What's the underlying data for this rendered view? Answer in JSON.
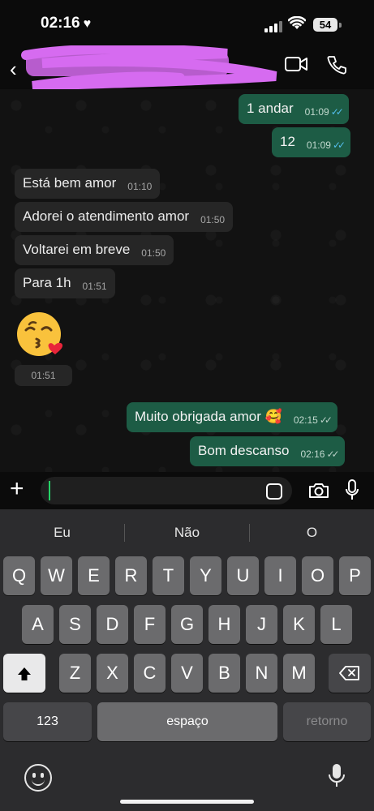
{
  "status": {
    "time": "02:16",
    "battery": "54"
  },
  "chat": {
    "messages": [
      {
        "dir": "out",
        "text": "1 andar",
        "time": "01:09",
        "read": true
      },
      {
        "dir": "out",
        "text": "12",
        "time": "01:09",
        "read": true
      },
      {
        "dir": "in",
        "text": "Está bem amor",
        "time": "01:10"
      },
      {
        "dir": "in",
        "text": "Adorei o atendimento amor",
        "time": "01:50"
      },
      {
        "dir": "in",
        "text": "Voltarei em breve",
        "time": "01:50"
      },
      {
        "dir": "in",
        "text": "Para 1h",
        "time": "01:51"
      },
      {
        "dir": "in",
        "text": "😘",
        "time": "01:51"
      },
      {
        "dir": "out",
        "text": "Muito obrigada amor 🥰",
        "time": "02:15",
        "read": false
      },
      {
        "dir": "out",
        "text": "Bom descanso",
        "time": "02:16",
        "read": false
      }
    ]
  },
  "keyboard": {
    "suggestions": [
      "Eu",
      "Não",
      "O"
    ],
    "row1": [
      "Q",
      "W",
      "E",
      "R",
      "T",
      "Y",
      "U",
      "I",
      "O",
      "P"
    ],
    "row2": [
      "A",
      "S",
      "D",
      "F",
      "G",
      "H",
      "J",
      "K",
      "L"
    ],
    "row3": [
      "Z",
      "X",
      "C",
      "V",
      "B",
      "N",
      "M"
    ],
    "numbers_label": "123",
    "space_label": "espaço",
    "return_label": "retorno"
  },
  "colors": {
    "outgoing_bubble": "#1d5c45",
    "incoming_bubble": "#262626",
    "read_ticks": "#53bdeb"
  }
}
